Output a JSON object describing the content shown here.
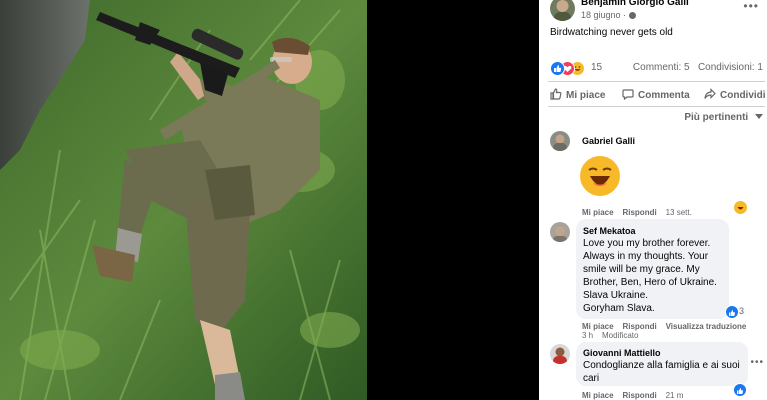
{
  "post": {
    "author": "Benjamin Giorgio Galli",
    "date": "18 giugno ·",
    "caption": "Birdwatching never gets old",
    "more_icon": "more-horizontal-icon",
    "privacy_icon": "globe-icon"
  },
  "reactions": {
    "types": [
      "like",
      "love",
      "haha"
    ],
    "count": "15",
    "comments": "Commenti: 5",
    "shares": "Condivisioni: 1"
  },
  "actions": {
    "like": "Mi piace",
    "comment": "Commenta",
    "share": "Condividi"
  },
  "sort": {
    "label": "Più pertinenti"
  },
  "comments": [
    {
      "name": "Gabriel Galli",
      "sticker": "laughing-emoji",
      "like": "Mi piace",
      "reply": "Rispondi",
      "time": "13 sett."
    },
    {
      "name": "Sef Mekatoa",
      "lines": [
        "Love you my brother forever.",
        "Always in my thoughts. Your",
        "smile will be my grace. My",
        "Brother, Ben, Hero of Ukraine.",
        "Slava Ukraine.",
        "Goryham Slava."
      ],
      "reaction_count": "3",
      "like": "Mi piace",
      "reply": "Rispondi",
      "translate": "Visualizza traduzione",
      "time": "3 h",
      "edited": "Modificato"
    },
    {
      "name": "Giovanni Mattiello",
      "lines": [
        "Condoglianze alla famiglia e ai suoi",
        "cari"
      ],
      "like": "Mi piace",
      "reply": "Rispondi",
      "time": "21 m"
    }
  ],
  "colors": {
    "accent": "#1877f2",
    "secondary_text": "#65676b",
    "bubble": "#f0f2f5"
  }
}
